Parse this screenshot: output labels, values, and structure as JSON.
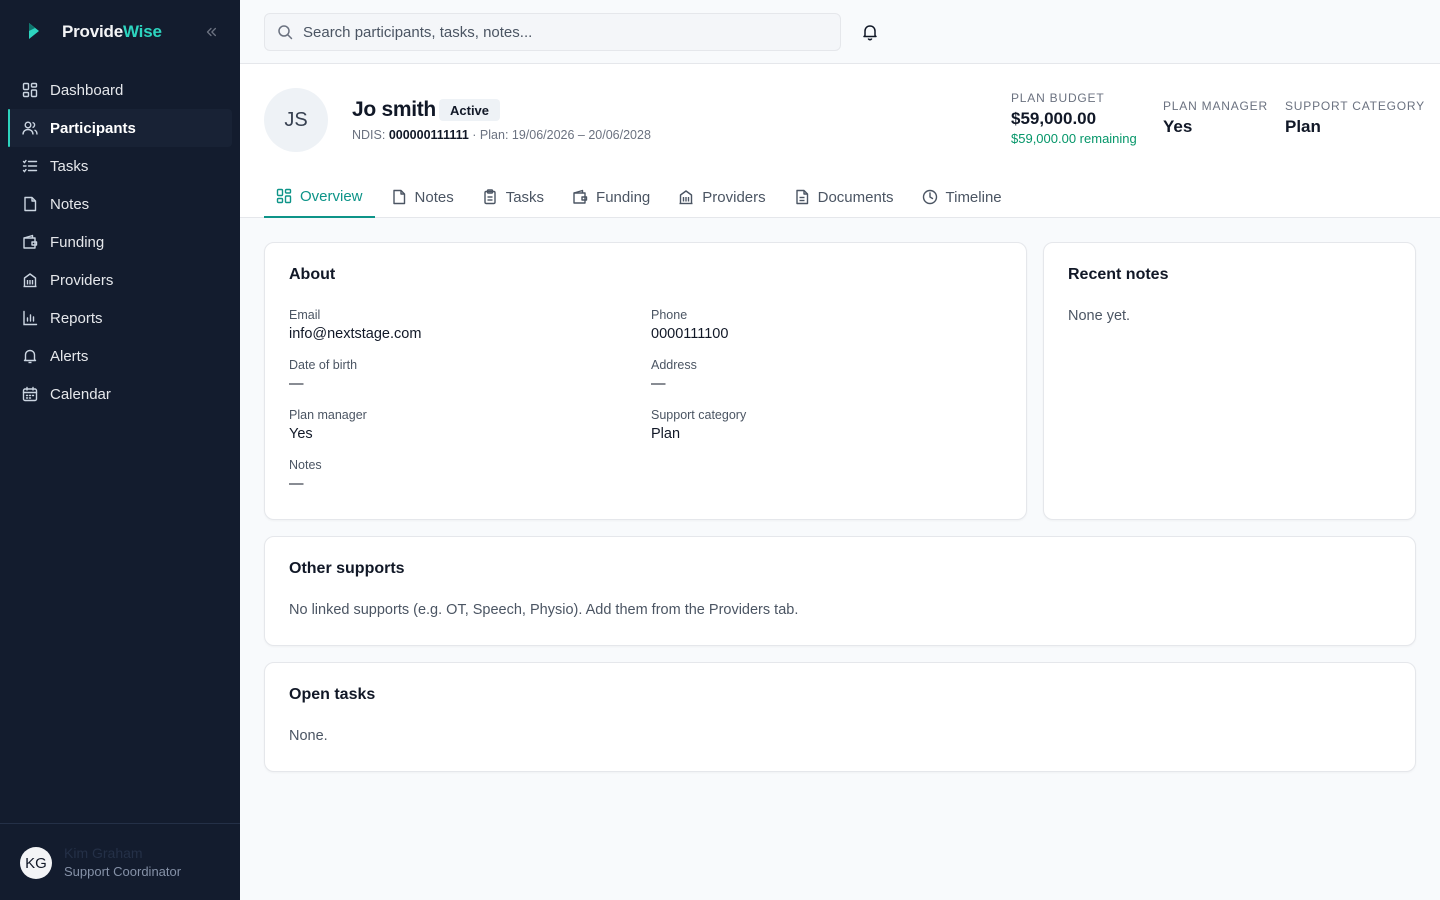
{
  "brand": {
    "name_part1": "Provide",
    "name_part2": "Wise"
  },
  "sidebar": {
    "items": [
      {
        "label": "Dashboard",
        "icon": "grid-icon"
      },
      {
        "label": "Participants",
        "icon": "users-icon"
      },
      {
        "label": "Tasks",
        "icon": "list-icon"
      },
      {
        "label": "Notes",
        "icon": "file-icon"
      },
      {
        "label": "Funding",
        "icon": "wallet-icon"
      },
      {
        "label": "Providers",
        "icon": "building-icon"
      },
      {
        "label": "Reports",
        "icon": "chart-icon"
      },
      {
        "label": "Alerts",
        "icon": "bell-icon"
      },
      {
        "label": "Calendar",
        "icon": "calendar-icon"
      }
    ],
    "active_index": 1,
    "user": {
      "initials": "KG",
      "name": "Kim Graham",
      "role": "Support Coordinator"
    }
  },
  "search": {
    "placeholder": "Search participants, tasks, notes..."
  },
  "participant": {
    "initials": "JS",
    "name": "Jo smith",
    "status": "Active",
    "ndis_label": "NDIS:",
    "ndis_number": "000000111111",
    "plan_text": "· Plan: 19/06/2026 – 20/06/2028"
  },
  "stats": {
    "plan_budget": {
      "label": "Plan budget",
      "value": "$59,000.00",
      "sub": "$59,000.00 remaining"
    },
    "plan_manager": {
      "label": "Plan manager",
      "value": "Yes"
    },
    "support_category": {
      "label": "Support category",
      "value": "Plan"
    }
  },
  "tabs": [
    {
      "label": "Overview",
      "icon": "overview-grid-icon"
    },
    {
      "label": "Notes",
      "icon": "file-icon"
    },
    {
      "label": "Tasks",
      "icon": "clipboard-icon"
    },
    {
      "label": "Funding",
      "icon": "wallet-icon"
    },
    {
      "label": "Providers",
      "icon": "building-icon"
    },
    {
      "label": "Documents",
      "icon": "document-icon"
    },
    {
      "label": "Timeline",
      "icon": "clock-icon"
    }
  ],
  "about": {
    "title": "About",
    "fields": [
      {
        "label": "Email",
        "value": "info@nextstage.com"
      },
      {
        "label": "Phone",
        "value": "0000111100"
      },
      {
        "label": "Date of birth",
        "value": "—"
      },
      {
        "label": "Address",
        "value": "—"
      },
      {
        "label": "Plan manager",
        "value": "Yes"
      },
      {
        "label": "Support category",
        "value": "Plan"
      },
      {
        "label": "Notes",
        "value": "—"
      }
    ]
  },
  "recent_notes": {
    "title": "Recent notes",
    "empty": "None yet."
  },
  "other_supports": {
    "title": "Other supports",
    "empty": "No linked supports (e.g. OT, Speech, Physio). Add them from the Providers tab."
  },
  "open_tasks": {
    "title": "Open tasks",
    "empty": "None."
  },
  "colors": {
    "accent": "#0d9488",
    "sidebar_bg": "#131c2e",
    "success": "#059669"
  }
}
